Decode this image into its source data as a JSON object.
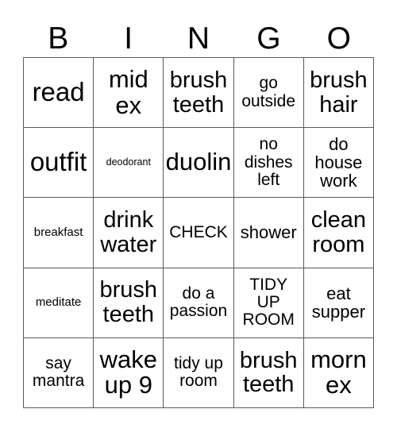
{
  "card": {
    "headers": [
      "B",
      "I",
      "N",
      "G",
      "O"
    ],
    "rows": [
      [
        {
          "text": "read",
          "size": "xxl"
        },
        {
          "text": "mid\nex",
          "size": "xl"
        },
        {
          "text": "brush\nteeth",
          "size": "lg"
        },
        {
          "text": "go\noutside",
          "size": "sm"
        },
        {
          "text": "brush\nhair",
          "size": "lg"
        }
      ],
      [
        {
          "text": "outfit",
          "size": "xxl"
        },
        {
          "text": "deodorant",
          "size": "xxs"
        },
        {
          "text": "duolin",
          "size": "xl"
        },
        {
          "text": "no\ndishes\nleft",
          "size": "sm"
        },
        {
          "text": "do\nhouse\nwork",
          "size": "md"
        }
      ],
      [
        {
          "text": "breakfast",
          "size": "xs"
        },
        {
          "text": "drink\nwater",
          "size": "lg"
        },
        {
          "text": "CHECK",
          "size": "sm"
        },
        {
          "text": "shower",
          "size": "md"
        },
        {
          "text": "clean\nroom",
          "size": "lg"
        }
      ],
      [
        {
          "text": "meditate",
          "size": "xs"
        },
        {
          "text": "brush\nteeth",
          "size": "lg"
        },
        {
          "text": "do a\npassion",
          "size": "sm"
        },
        {
          "text": "TIDY\nUP\nROOM",
          "size": "sm"
        },
        {
          "text": "eat\nsupper",
          "size": "md"
        }
      ],
      [
        {
          "text": "say\nmantra",
          "size": "sm"
        },
        {
          "text": "wake\nup 9",
          "size": "xl"
        },
        {
          "text": "tidy up\nroom",
          "size": "sm"
        },
        {
          "text": "brush\nteeth",
          "size": "lg"
        },
        {
          "text": "morn\nex",
          "size": "xl"
        }
      ]
    ]
  },
  "colors": {
    "background": "#ffffff",
    "text": "#000000",
    "grid_line": "#5a5a5a"
  }
}
